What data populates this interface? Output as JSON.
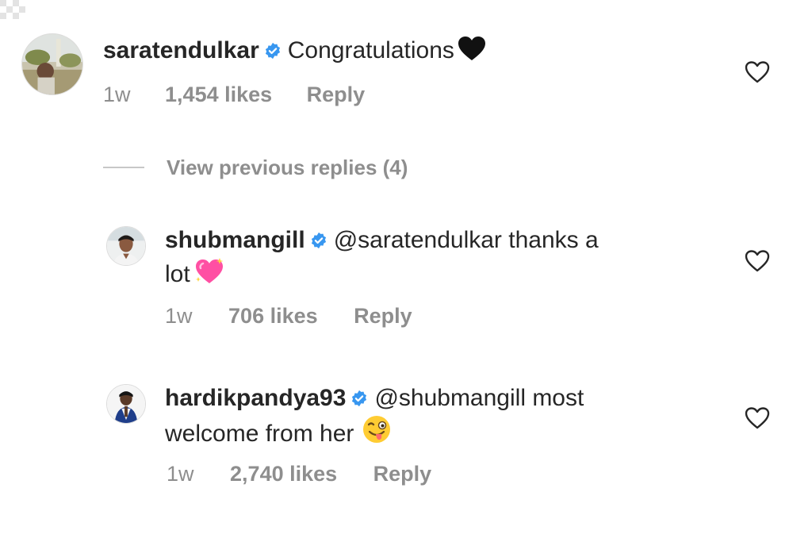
{
  "comments": [
    {
      "username": "saratendulkar",
      "verified": true,
      "text": "Congratulations",
      "emoji": "black-heart",
      "time": "1w",
      "likes": "1,454 likes",
      "reply_label": "Reply"
    },
    {
      "username": "shubmangill",
      "verified": true,
      "text_line1": "@saratendulkar thanks a",
      "text_line2": "lot",
      "emoji": "sparkling-heart",
      "time": "1w",
      "likes": "706 likes",
      "reply_label": "Reply"
    },
    {
      "username": "hardikpandya93",
      "verified": true,
      "text_line1": "@shubmangill most",
      "text_line2": "welcome from her",
      "emoji": "winking-face-with-tongue",
      "time": "1w",
      "likes": "2,740 likes",
      "reply_label": "Reply"
    }
  ],
  "view_replies": {
    "label": "View previous replies (4)"
  },
  "colors": {
    "verified_badge": "#3897f0",
    "meta_text": "#8e8e8e",
    "primary_text": "#262626"
  }
}
